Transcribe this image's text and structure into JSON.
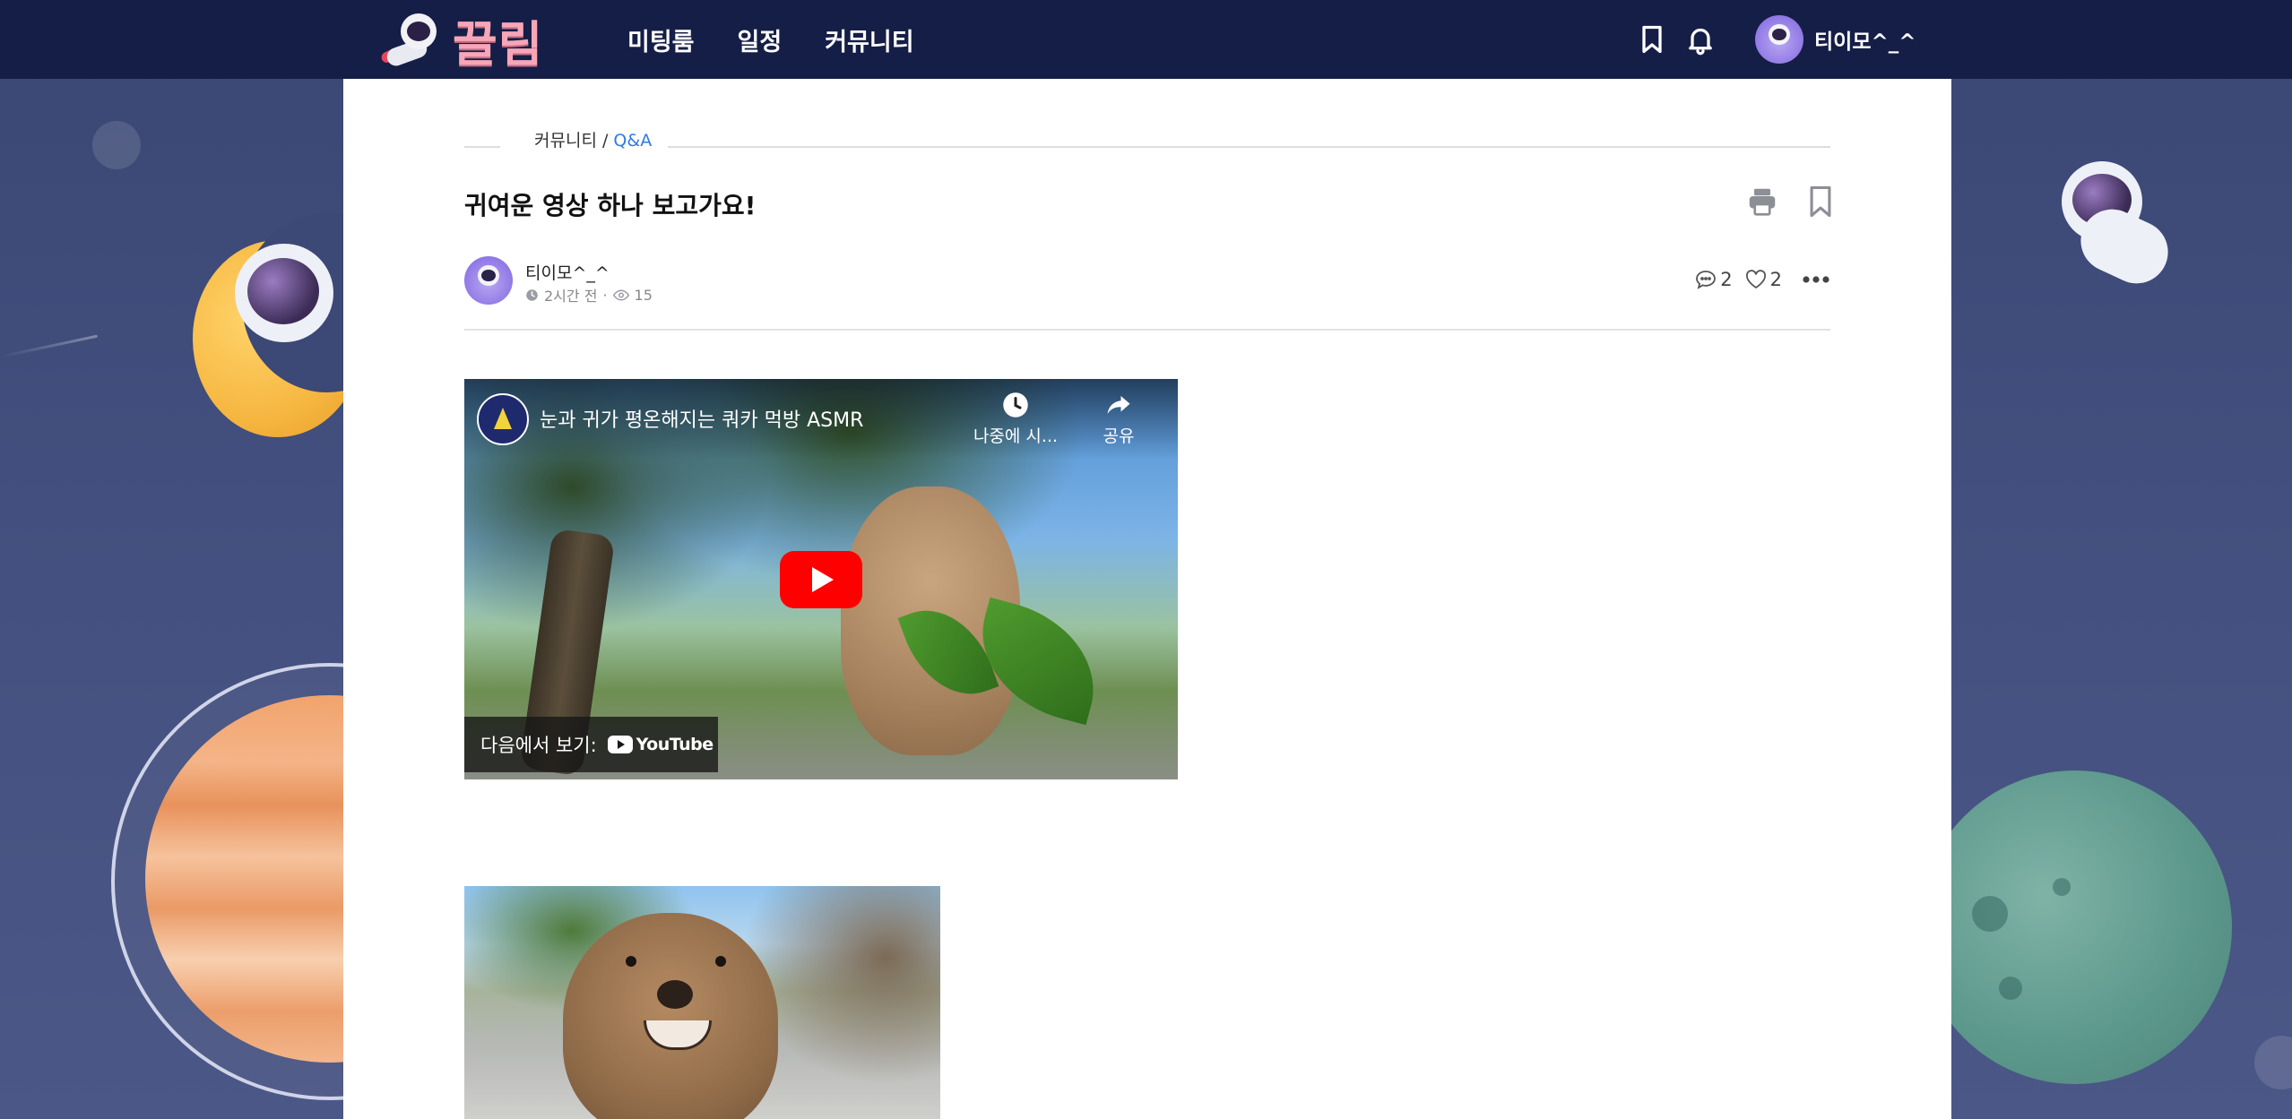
{
  "brand": {
    "name": "끌림"
  },
  "nav": {
    "items": [
      {
        "label": "미팅룸"
      },
      {
        "label": "일정"
      },
      {
        "label": "커뮤니티"
      }
    ]
  },
  "user": {
    "name": "티이모^_^"
  },
  "breadcrumb": {
    "section": "커뮤니티",
    "separator": "/",
    "current": "Q&A"
  },
  "post": {
    "title": "귀여운 영상 하나 보고가요!",
    "author": "티이모^_^",
    "time_ago": "2시간 전",
    "views": "15",
    "comments": "2",
    "likes": "2"
  },
  "video": {
    "title": "눈과 귀가 평온해지는 쿼카 먹방 ASMR",
    "watch_later_label": "나중에 시...",
    "share_label": "공유",
    "watch_on_label": "다음에서 보기:",
    "platform_label": "YouTube"
  },
  "colors": {
    "nav_bg": "#151e46",
    "page_bg": "#434f7e",
    "accent_link": "#2f7be0",
    "logo_pink": "#f6a6b7",
    "play_red": "#ff0000"
  },
  "icons": {
    "bookmark": "bookmark-icon",
    "bell": "bell-icon",
    "print": "print-icon",
    "comment": "comment-icon",
    "heart": "heart-icon",
    "more": "more-icon",
    "clock": "clock-icon",
    "eye": "eye-icon",
    "share": "share-icon"
  }
}
